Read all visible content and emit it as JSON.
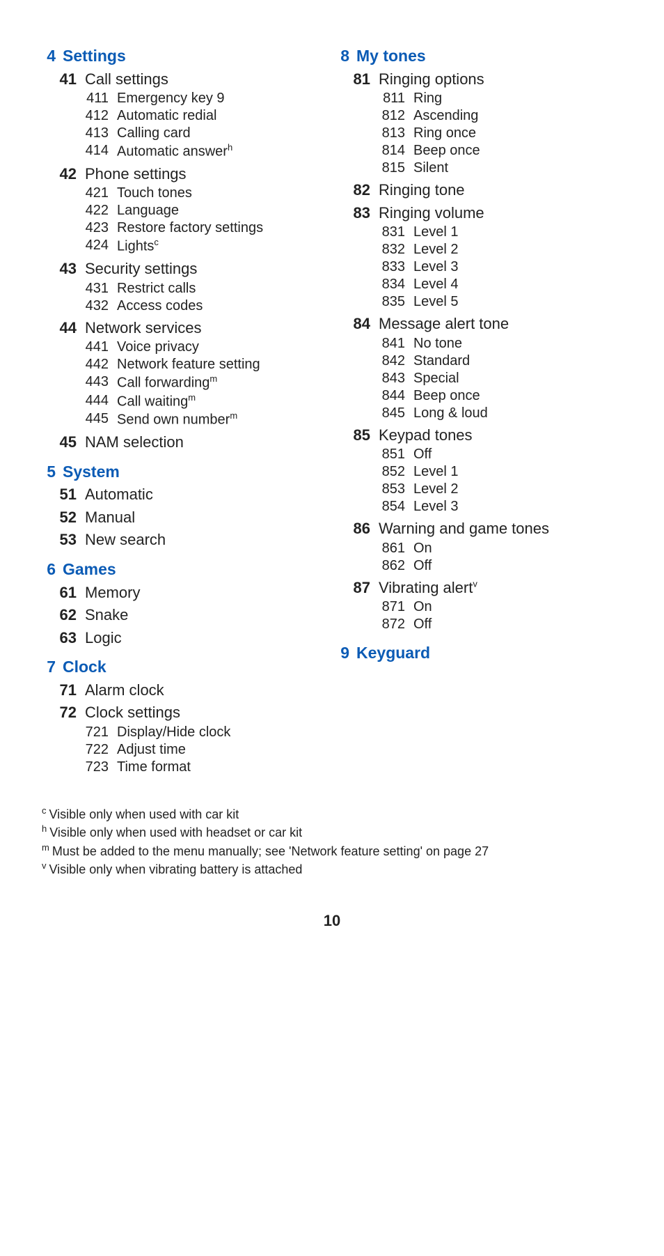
{
  "page_number": "10",
  "left_sections": [
    {
      "num": "4",
      "title": "Settings",
      "items": [
        {
          "num": "41",
          "label": "Call settings",
          "children": [
            {
              "num": "411",
              "label": "Emergency key 9"
            },
            {
              "num": "412",
              "label": "Automatic redial"
            },
            {
              "num": "413",
              "label": "Calling card"
            },
            {
              "num": "414",
              "label": "Automatic answer",
              "sup": "h"
            }
          ]
        },
        {
          "num": "42",
          "label": "Phone settings",
          "children": [
            {
              "num": "421",
              "label": "Touch tones"
            },
            {
              "num": "422",
              "label": "Language"
            },
            {
              "num": "423",
              "label": "Restore factory settings"
            },
            {
              "num": "424",
              "label": "Lights",
              "sup": "c"
            }
          ]
        },
        {
          "num": "43",
          "label": "Security settings",
          "children": [
            {
              "num": "431",
              "label": "Restrict calls"
            },
            {
              "num": "432",
              "label": "Access codes"
            }
          ]
        },
        {
          "num": "44",
          "label": "Network services",
          "children": [
            {
              "num": "441",
              "label": "Voice privacy"
            },
            {
              "num": "442",
              "label": "Network feature setting"
            },
            {
              "num": "443",
              "label": "Call forwarding",
              "sup": "m"
            },
            {
              "num": "444",
              "label": "Call waiting",
              "sup": "m"
            },
            {
              "num": "445",
              "label": "Send own number",
              "sup": "m"
            }
          ]
        },
        {
          "num": "45",
          "label": "NAM selection"
        }
      ]
    },
    {
      "num": "5",
      "title": "System",
      "items": [
        {
          "num": "51",
          "label": "Automatic"
        },
        {
          "num": "52",
          "label": "Manual"
        },
        {
          "num": "53",
          "label": "New search"
        }
      ]
    },
    {
      "num": "6",
      "title": "Games",
      "items": [
        {
          "num": "61",
          "label": "Memory"
        },
        {
          "num": "62",
          "label": "Snake"
        },
        {
          "num": "63",
          "label": "Logic"
        }
      ]
    },
    {
      "num": "7",
      "title": "Clock",
      "items": [
        {
          "num": "71",
          "label": "Alarm clock"
        },
        {
          "num": "72",
          "label": "Clock settings",
          "children": [
            {
              "num": "721",
              "label": "Display/Hide clock"
            },
            {
              "num": "722",
              "label": "Adjust time"
            },
            {
              "num": "723",
              "label": "Time format"
            }
          ]
        }
      ]
    }
  ],
  "right_sections": [
    {
      "num": "8",
      "title": "My tones",
      "items": [
        {
          "num": "81",
          "label": "Ringing options",
          "children": [
            {
              "num": "811",
              "label": "Ring"
            },
            {
              "num": "812",
              "label": "Ascending"
            },
            {
              "num": "813",
              "label": "Ring once"
            },
            {
              "num": "814",
              "label": "Beep once"
            },
            {
              "num": "815",
              "label": "Silent"
            }
          ]
        },
        {
          "num": "82",
          "label": "Ringing tone"
        },
        {
          "num": "83",
          "label": "Ringing volume",
          "children": [
            {
              "num": "831",
              "label": "Level 1"
            },
            {
              "num": "832",
              "label": "Level 2"
            },
            {
              "num": "833",
              "label": "Level 3"
            },
            {
              "num": "834",
              "label": "Level 4"
            },
            {
              "num": "835",
              "label": "Level 5"
            }
          ]
        },
        {
          "num": "84",
          "label": "Message alert tone",
          "children": [
            {
              "num": "841",
              "label": "No tone"
            },
            {
              "num": "842",
              "label": "Standard"
            },
            {
              "num": "843",
              "label": "Special"
            },
            {
              "num": "844",
              "label": "Beep once"
            },
            {
              "num": "845",
              "label": "Long & loud"
            }
          ]
        },
        {
          "num": "85",
          "label": "Keypad tones",
          "children": [
            {
              "num": "851",
              "label": "Off"
            },
            {
              "num": "852",
              "label": "Level 1"
            },
            {
              "num": "853",
              "label": "Level 2"
            },
            {
              "num": "854",
              "label": "Level 3"
            }
          ]
        },
        {
          "num": "86",
          "label": "Warning and game tones",
          "children": [
            {
              "num": "861",
              "label": "On"
            },
            {
              "num": "862",
              "label": "Off"
            }
          ]
        },
        {
          "num": "87",
          "label": "Vibrating alert",
          "sup": "v",
          "children": [
            {
              "num": "871",
              "label": "On"
            },
            {
              "num": "872",
              "label": "Off"
            }
          ]
        }
      ]
    },
    {
      "num": "9",
      "title": "Keyguard",
      "items": []
    }
  ],
  "footnotes": [
    {
      "mark": "c",
      "text": "Visible only when used with car kit"
    },
    {
      "mark": "h",
      "text": "Visible only when used with headset or car kit"
    },
    {
      "mark": "m",
      "text": "Must be added to the menu manually; see 'Network feature setting' on page 27"
    },
    {
      "mark": "v",
      "text": "Visible only when vibrating battery is attached"
    }
  ]
}
